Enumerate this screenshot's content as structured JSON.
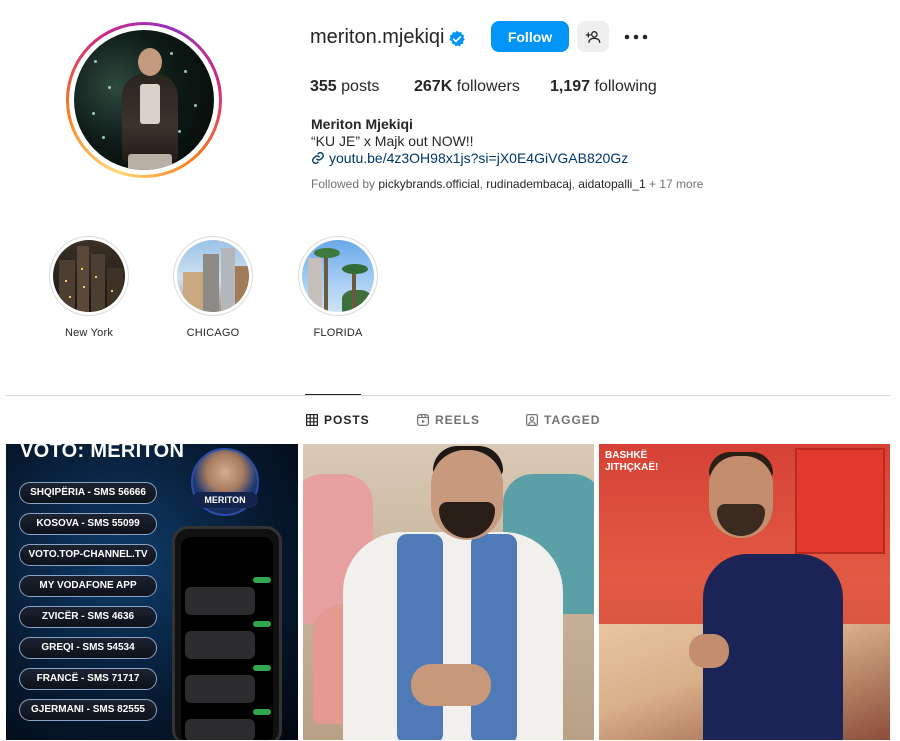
{
  "profile": {
    "username": "meriton.mjekiqi",
    "verified": true,
    "follow_label": "Follow",
    "full_name": "Meriton Mjekiqi",
    "bio": "“KU JE” x Majk out NOW!!",
    "link": "youtu.be/4z3OH98x1js?si=jX0E4GiVGAB820Gz",
    "stats": {
      "posts_count": "355",
      "posts_label": " posts",
      "followers_count": "267K",
      "followers_label": " followers",
      "following_count": "1,197",
      "following_label": " following"
    },
    "followed_by": {
      "prefix": "Followed by ",
      "accounts": [
        "pickybrands.official",
        "rudinadembacaj",
        "aidatopalli_1"
      ],
      "suffix": " + 17 more"
    }
  },
  "highlights": [
    {
      "label": "New York"
    },
    {
      "label": "CHICAGO"
    },
    {
      "label": "FLORIDA"
    }
  ],
  "tabs": [
    {
      "label": "POSTS",
      "active": true
    },
    {
      "label": "REELS",
      "active": false
    },
    {
      "label": "TAGGED",
      "active": false
    }
  ],
  "posts": {
    "post1": {
      "title": "VOTO: MERITON",
      "badge": "MERITON",
      "pills": [
        "SHQIPËRIA - SMS 56666",
        "KOSOVA - SMS 55099",
        "VOTO.TOP-CHANNEL.TV",
        "MY VODAFONE APP",
        "ZVICËR - SMS 4636",
        "GREQI - SMS 54534",
        "FRANCË - SMS 71717",
        "GJERMANI - SMS 82555"
      ]
    },
    "post3": {
      "wall_text": "BASHKË\nJITHÇKAË!"
    }
  },
  "colors": {
    "accent": "#0095f6",
    "text": "#262626",
    "secondary_text": "#737373",
    "link": "#00376b"
  }
}
